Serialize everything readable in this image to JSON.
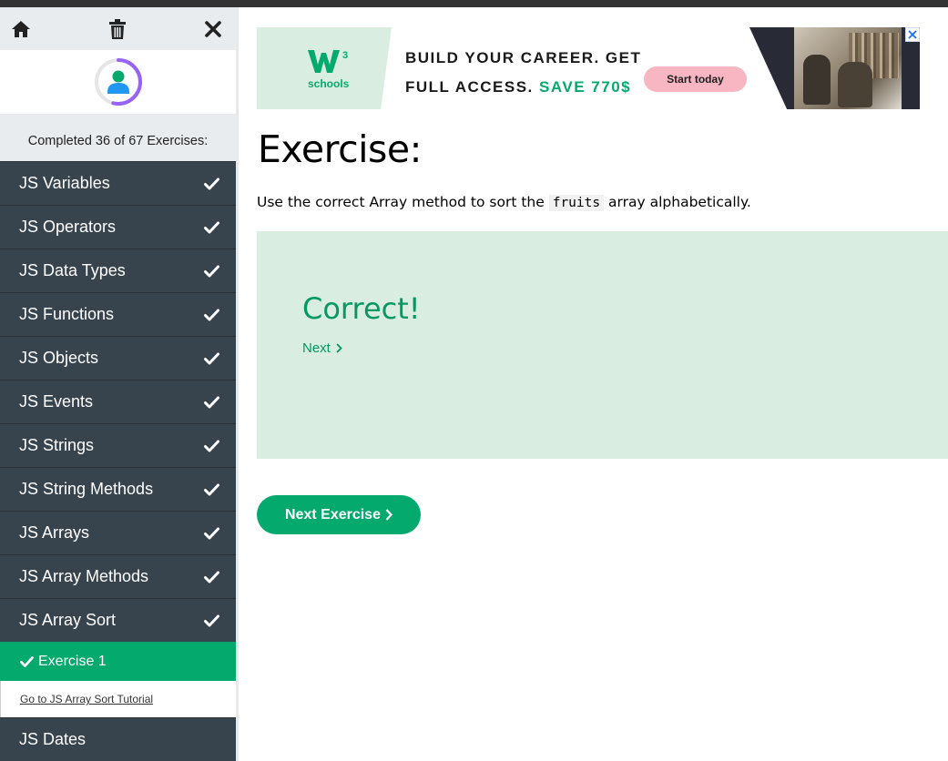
{
  "toolbar": {
    "home_icon": "home-icon",
    "trash_icon": "trash-icon",
    "close_icon": "close-icon"
  },
  "progress": {
    "text": "Completed 36 of 67 Exercises:",
    "completed": 36,
    "total": 67
  },
  "menu": {
    "items": [
      {
        "label": "JS Variables",
        "done": true
      },
      {
        "label": "JS Operators",
        "done": true
      },
      {
        "label": "JS Data Types",
        "done": true
      },
      {
        "label": "JS Functions",
        "done": true
      },
      {
        "label": "JS Objects",
        "done": true
      },
      {
        "label": "JS Events",
        "done": true
      },
      {
        "label": "JS Strings",
        "done": true
      },
      {
        "label": "JS String Methods",
        "done": true
      },
      {
        "label": "JS Arrays",
        "done": true
      },
      {
        "label": "JS Array Methods",
        "done": true
      },
      {
        "label": "JS Array Sort",
        "done": true
      },
      {
        "label": "JS Dates",
        "done": false
      }
    ],
    "sub_exercise": "Exercise 1",
    "tutorial_link": "Go to JS Array Sort Tutorial"
  },
  "ad": {
    "brand_mark": "W3",
    "brand_sub": "schools",
    "line1": "BUILD YOUR CAREER. GET",
    "line2": "FULL ACCESS.",
    "save": "SAVE 770$",
    "cta": "Start today"
  },
  "main": {
    "heading": "Exercise:",
    "instruction_before": "Use the correct Array method to sort the",
    "instruction_code": "fruits",
    "instruction_after": "array alphabetically.",
    "result": "Correct!",
    "next_link": "Next",
    "next_button": "Next Exercise"
  },
  "colors": {
    "brand_green": "#04aa6d",
    "sidebar_bg": "#38444d",
    "success_bg": "#d9eee1",
    "success_text": "#059862"
  }
}
